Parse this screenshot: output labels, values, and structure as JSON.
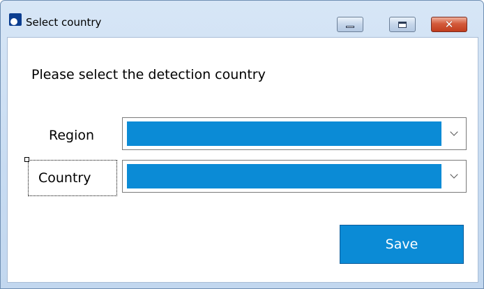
{
  "window": {
    "title": "Select country",
    "app_icon": "app-logo-icon",
    "controls": {
      "minimize_icon": "minimize-icon",
      "maximize_icon": "maximize-icon",
      "close_icon": "close-icon",
      "close_glyph": "✕"
    }
  },
  "form": {
    "prompt": "Please select the detection country",
    "region": {
      "label": "Region",
      "value": ""
    },
    "country": {
      "label": "Country",
      "value": ""
    },
    "save_label": "Save"
  },
  "colors": {
    "accent": "#0b8bd6",
    "close_button": "#c13d1d",
    "titlebar": "#d7e6f6"
  }
}
